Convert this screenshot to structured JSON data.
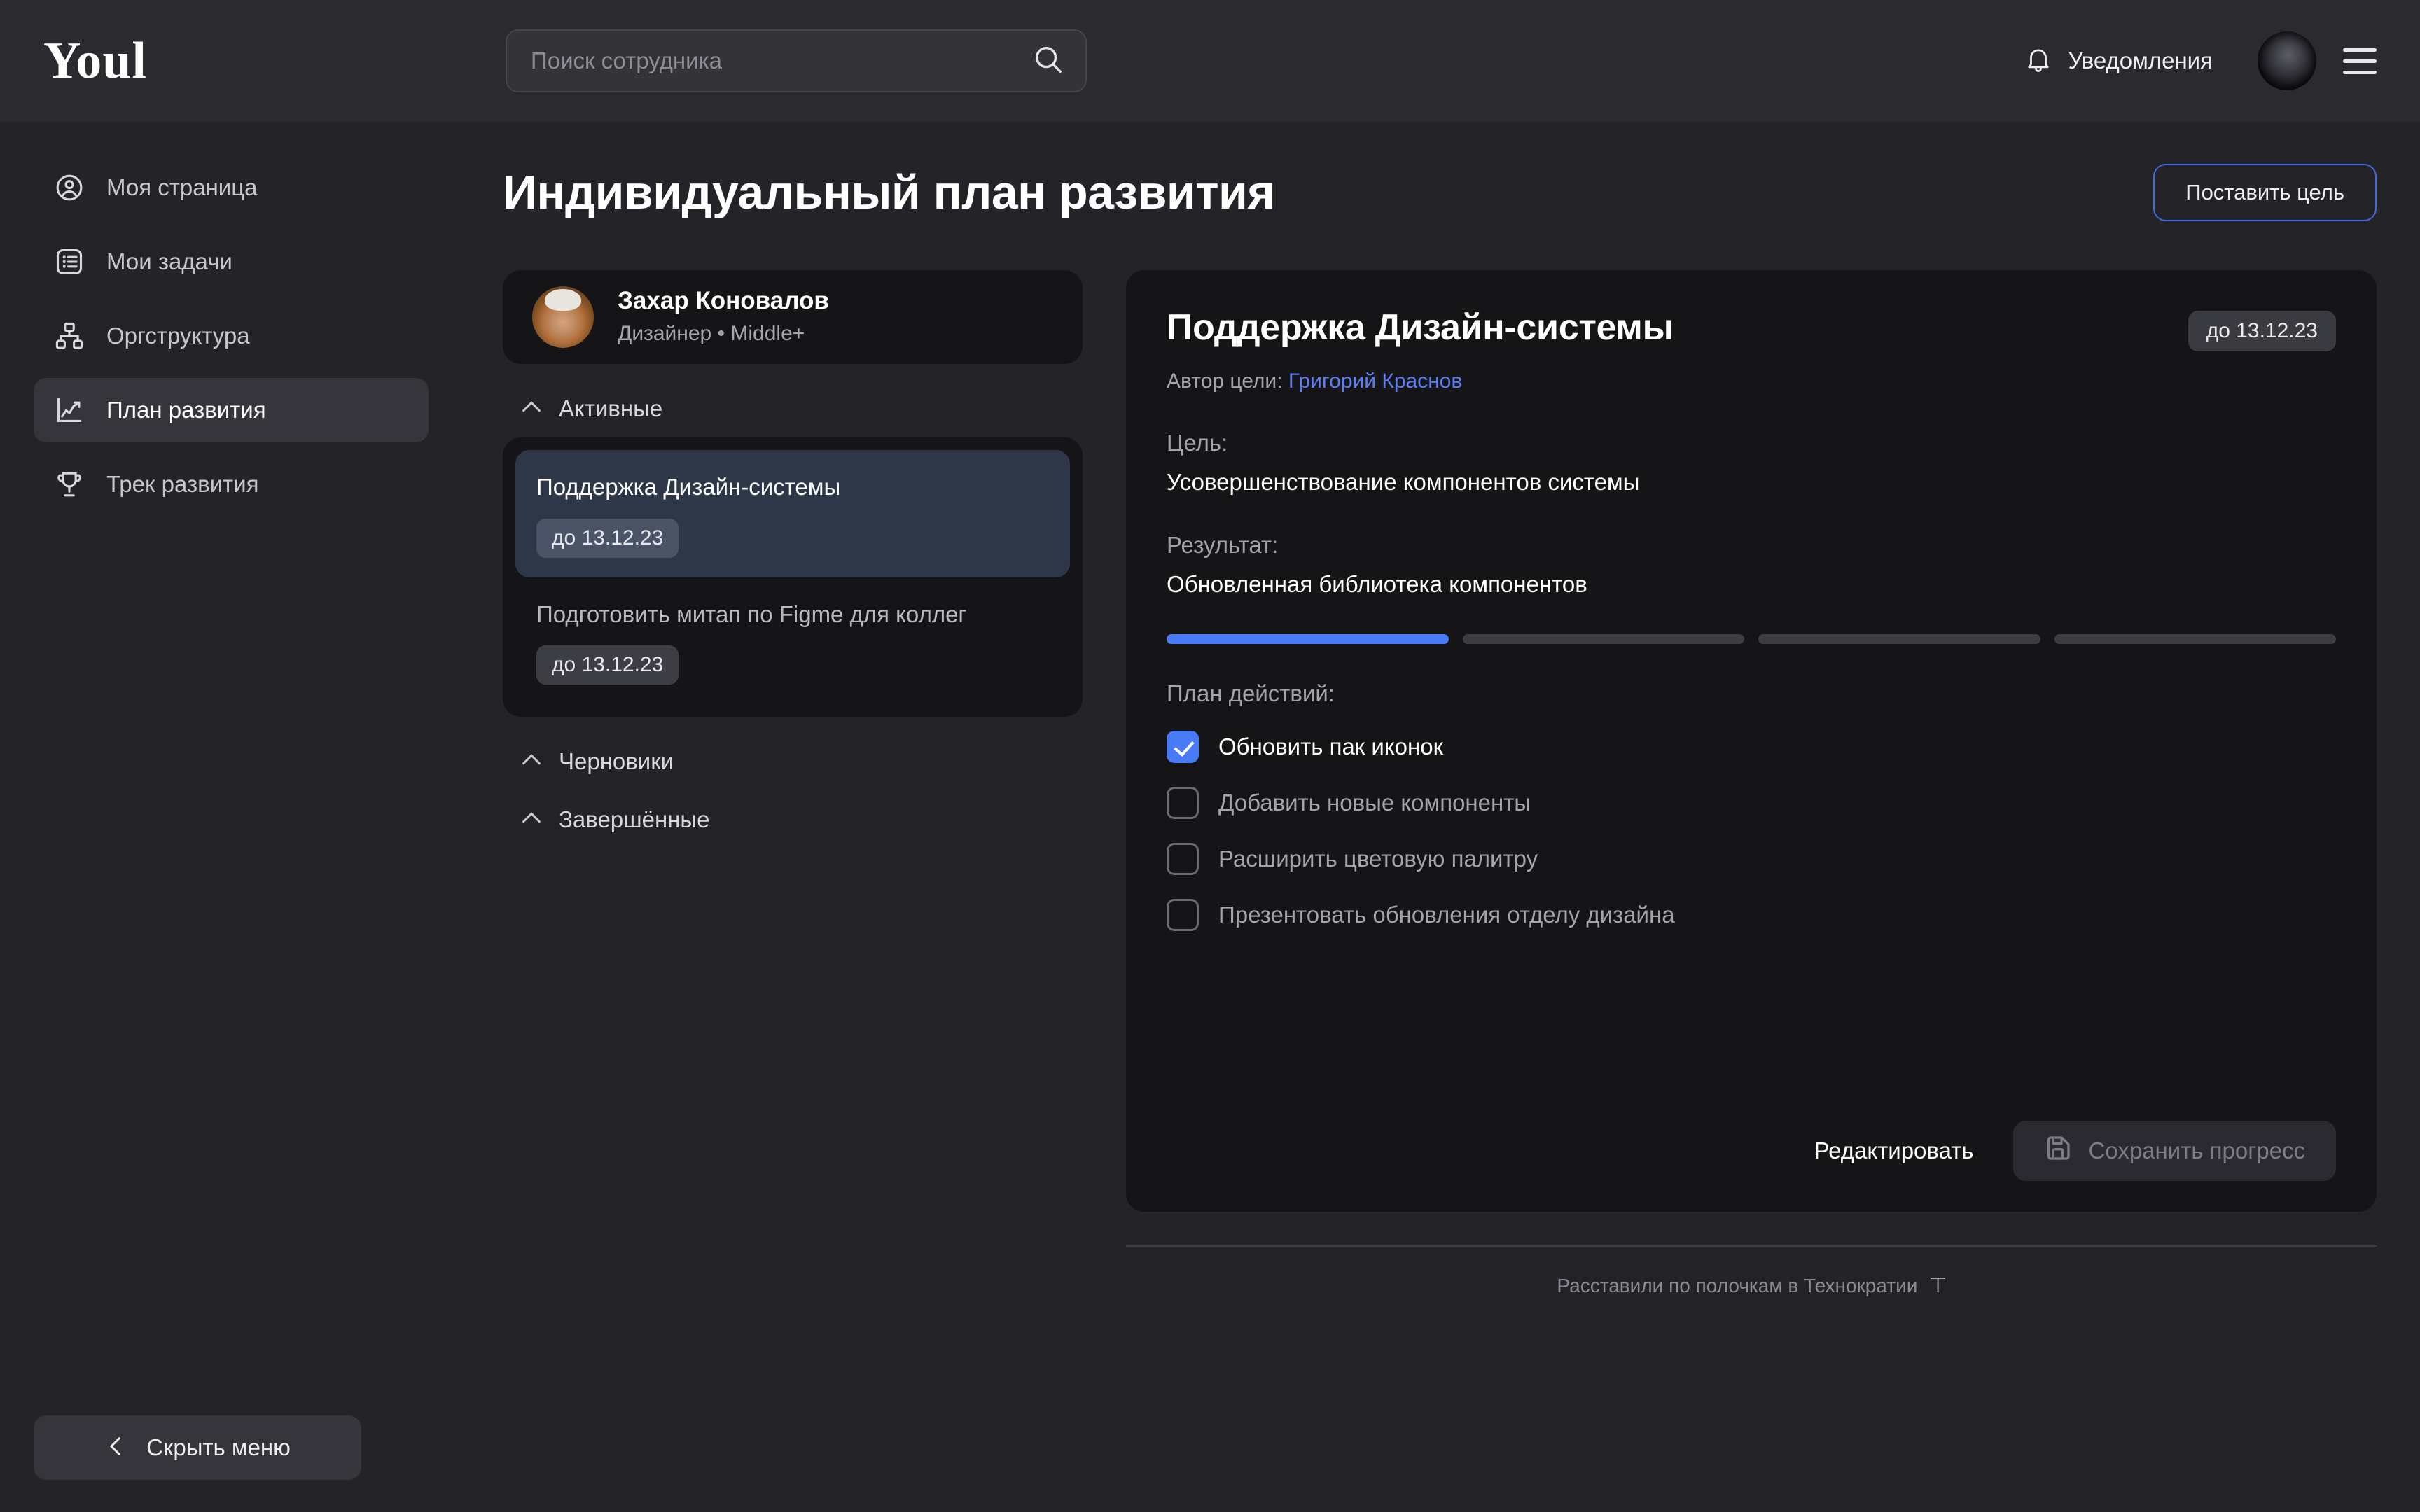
{
  "header": {
    "logo": "Youl",
    "search": {
      "placeholder": "Поиск сотрудника",
      "value": "",
      "icon": "search-icon"
    },
    "notifications_label": "Уведомления",
    "notifications_icon": "bell-icon",
    "avatar_icon": "user-avatar",
    "menu_icon": "hamburger-menu-icon"
  },
  "sidebar": {
    "items": [
      {
        "label": "Моя страница",
        "icon": "user-circle-icon",
        "active": false
      },
      {
        "label": "Мои задачи",
        "icon": "list-icon",
        "active": false
      },
      {
        "label": "Оргструктура",
        "icon": "org-chart-icon",
        "active": false
      },
      {
        "label": "План развития",
        "icon": "growth-chart-icon",
        "active": true
      },
      {
        "label": "Трек развития",
        "icon": "trophy-icon",
        "active": false
      }
    ],
    "hide_menu_label": "Скрыть меню",
    "hide_menu_icon": "chevron-left-icon"
  },
  "page": {
    "title": "Индивидуальный план развития",
    "primary_button": "Поставить цель"
  },
  "profile": {
    "name": "Захар Коновалов",
    "role": "Дизайнер • Middle+"
  },
  "goal_sections": [
    {
      "label": "Активные",
      "icon": "chevron-up-icon",
      "items": [
        {
          "title": "Поддержка Дизайн-системы",
          "date": "до 13.12.23",
          "selected": true
        },
        {
          "title": "Подготовить митап по Figme для коллег",
          "date": "до 13.12.23",
          "selected": false
        }
      ]
    },
    {
      "label": "Черновики",
      "icon": "chevron-up-icon",
      "items": []
    },
    {
      "label": "Завершённые",
      "icon": "chevron-up-icon",
      "items": []
    }
  ],
  "detail": {
    "title": "Поддержка Дизайн-системы",
    "date": "до 13.12.23",
    "author_label": "Автор цели:",
    "author_name": "Григорий Краснов",
    "goal_label": "Цель:",
    "goal_value": "Усовершенствование компонентов системы",
    "result_label": "Результат:",
    "result_value": "Обновленная библиотека компонентов",
    "progress": {
      "total": 4,
      "completed": 1
    },
    "plan_label": "План действий:",
    "plan_items": [
      {
        "label": "Обновить пак иконок",
        "checked": true
      },
      {
        "label": "Добавить новые компоненты",
        "checked": false
      },
      {
        "label": "Расширить цветовую палитру",
        "checked": false
      },
      {
        "label": "Презентовать обновления отделу дизайна",
        "checked": false
      }
    ],
    "edit_button": "Редактировать",
    "save_button": "Сохранить прогресс",
    "save_icon": "floppy-disk-icon"
  },
  "footer": {
    "text": "Расставили по полочкам в Технократии",
    "logo": "⊤"
  },
  "colors": {
    "accent_blue": "#4a7bf7",
    "link_blue": "#5d7cf5",
    "border_blue": "#4169e1",
    "page_bg": "#232328",
    "panel_bg": "#151518",
    "selected_card": "#2e3748"
  }
}
